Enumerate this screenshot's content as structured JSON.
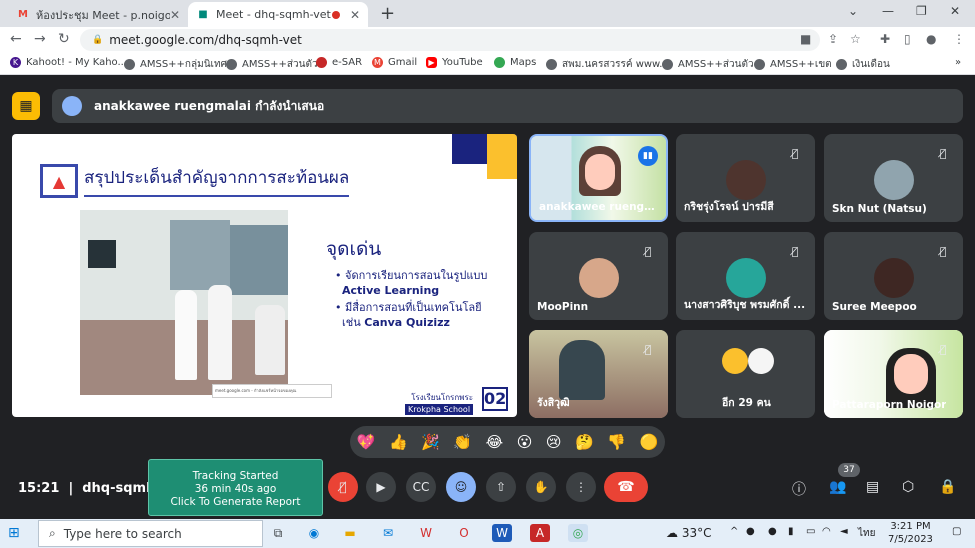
{
  "browser": {
    "tabs": [
      {
        "title": "ห้องประชุม Meet - p.noigor@gmai",
        "favicon": "gmail-icon"
      },
      {
        "title": "Meet - dhq-sqmh-vet",
        "favicon": "meet-icon",
        "recording": true
      }
    ],
    "url": "meet.google.com/dhq-sqmh-vet",
    "bookmarks": [
      "Kahoot! - My Kaho...",
      "AMSS++กลุ่มนิเทศ",
      "AMSS++ส่วนตัว",
      "e-SAR",
      "Gmail",
      "YouTube",
      "Maps",
      "สพม.นครสวรรค์ www....",
      "AMSS++ส่วนตัว",
      "AMSS++เขต",
      "เงินเดือน"
    ]
  },
  "meet": {
    "presenter_text": "anakkawee ruengmalai กำลังนำเสนอ",
    "slide": {
      "title": "สรุปประเด็นสำคัญจากการสะท้อนผล",
      "heading": "จุดเด่น",
      "bullet1_line1": "จัดการเรียนการสอนในรูปแบบ",
      "bullet1_line2": "Active Learning",
      "bullet2_line1": "มีสื่อการสอนที่เป็นเทคโนโลยี",
      "bullet2_line2_prefix": "เช่น ",
      "bullet2_line2_bold": "Canva Quizizz",
      "school_th": "โรงเรียนโกรกพระ",
      "school_en": "Krokpha School",
      "slide_number": "02",
      "meet_card_text": "meet.google.com - กำลังแชร์หน้าจอของคุณ"
    },
    "participants": [
      {
        "name": "anakkawee ruengma...",
        "muted": false,
        "speaking": true
      },
      {
        "name": "กริชรุ่งโรจน์ ปารมีสี",
        "muted": true
      },
      {
        "name": "Skn Nut (Natsu)",
        "muted": true
      },
      {
        "name": "MooPinn",
        "muted": true
      },
      {
        "name": "นางสาวศิริบุช พรมศักดิ์ ...",
        "muted": true
      },
      {
        "name": "Suree Meepoo",
        "muted": true
      },
      {
        "name": "รังสิวุฒิ",
        "muted": true
      },
      {
        "name": "อีก 29 คน",
        "muted": false
      },
      {
        "name": "Pattaraporn Noigor",
        "muted": true
      }
    ],
    "reactions": [
      "💖",
      "👍",
      "🎉",
      "👏",
      "😂",
      "😮",
      "😢",
      "🤔",
      "👎",
      "🟡"
    ],
    "time": "15:21",
    "meeting_code": "dhq-sqmh-...",
    "people_count": "37",
    "tracking": {
      "line1": "Tracking Started",
      "line2": "36 min 40s ago",
      "line3": "Click To Generate Report"
    }
  },
  "taskbar": {
    "search_placeholder": "Type here to search",
    "temperature": "33°C",
    "lang": "ไทย",
    "clock_time": "3:21 PM",
    "clock_date": "7/5/2023"
  }
}
